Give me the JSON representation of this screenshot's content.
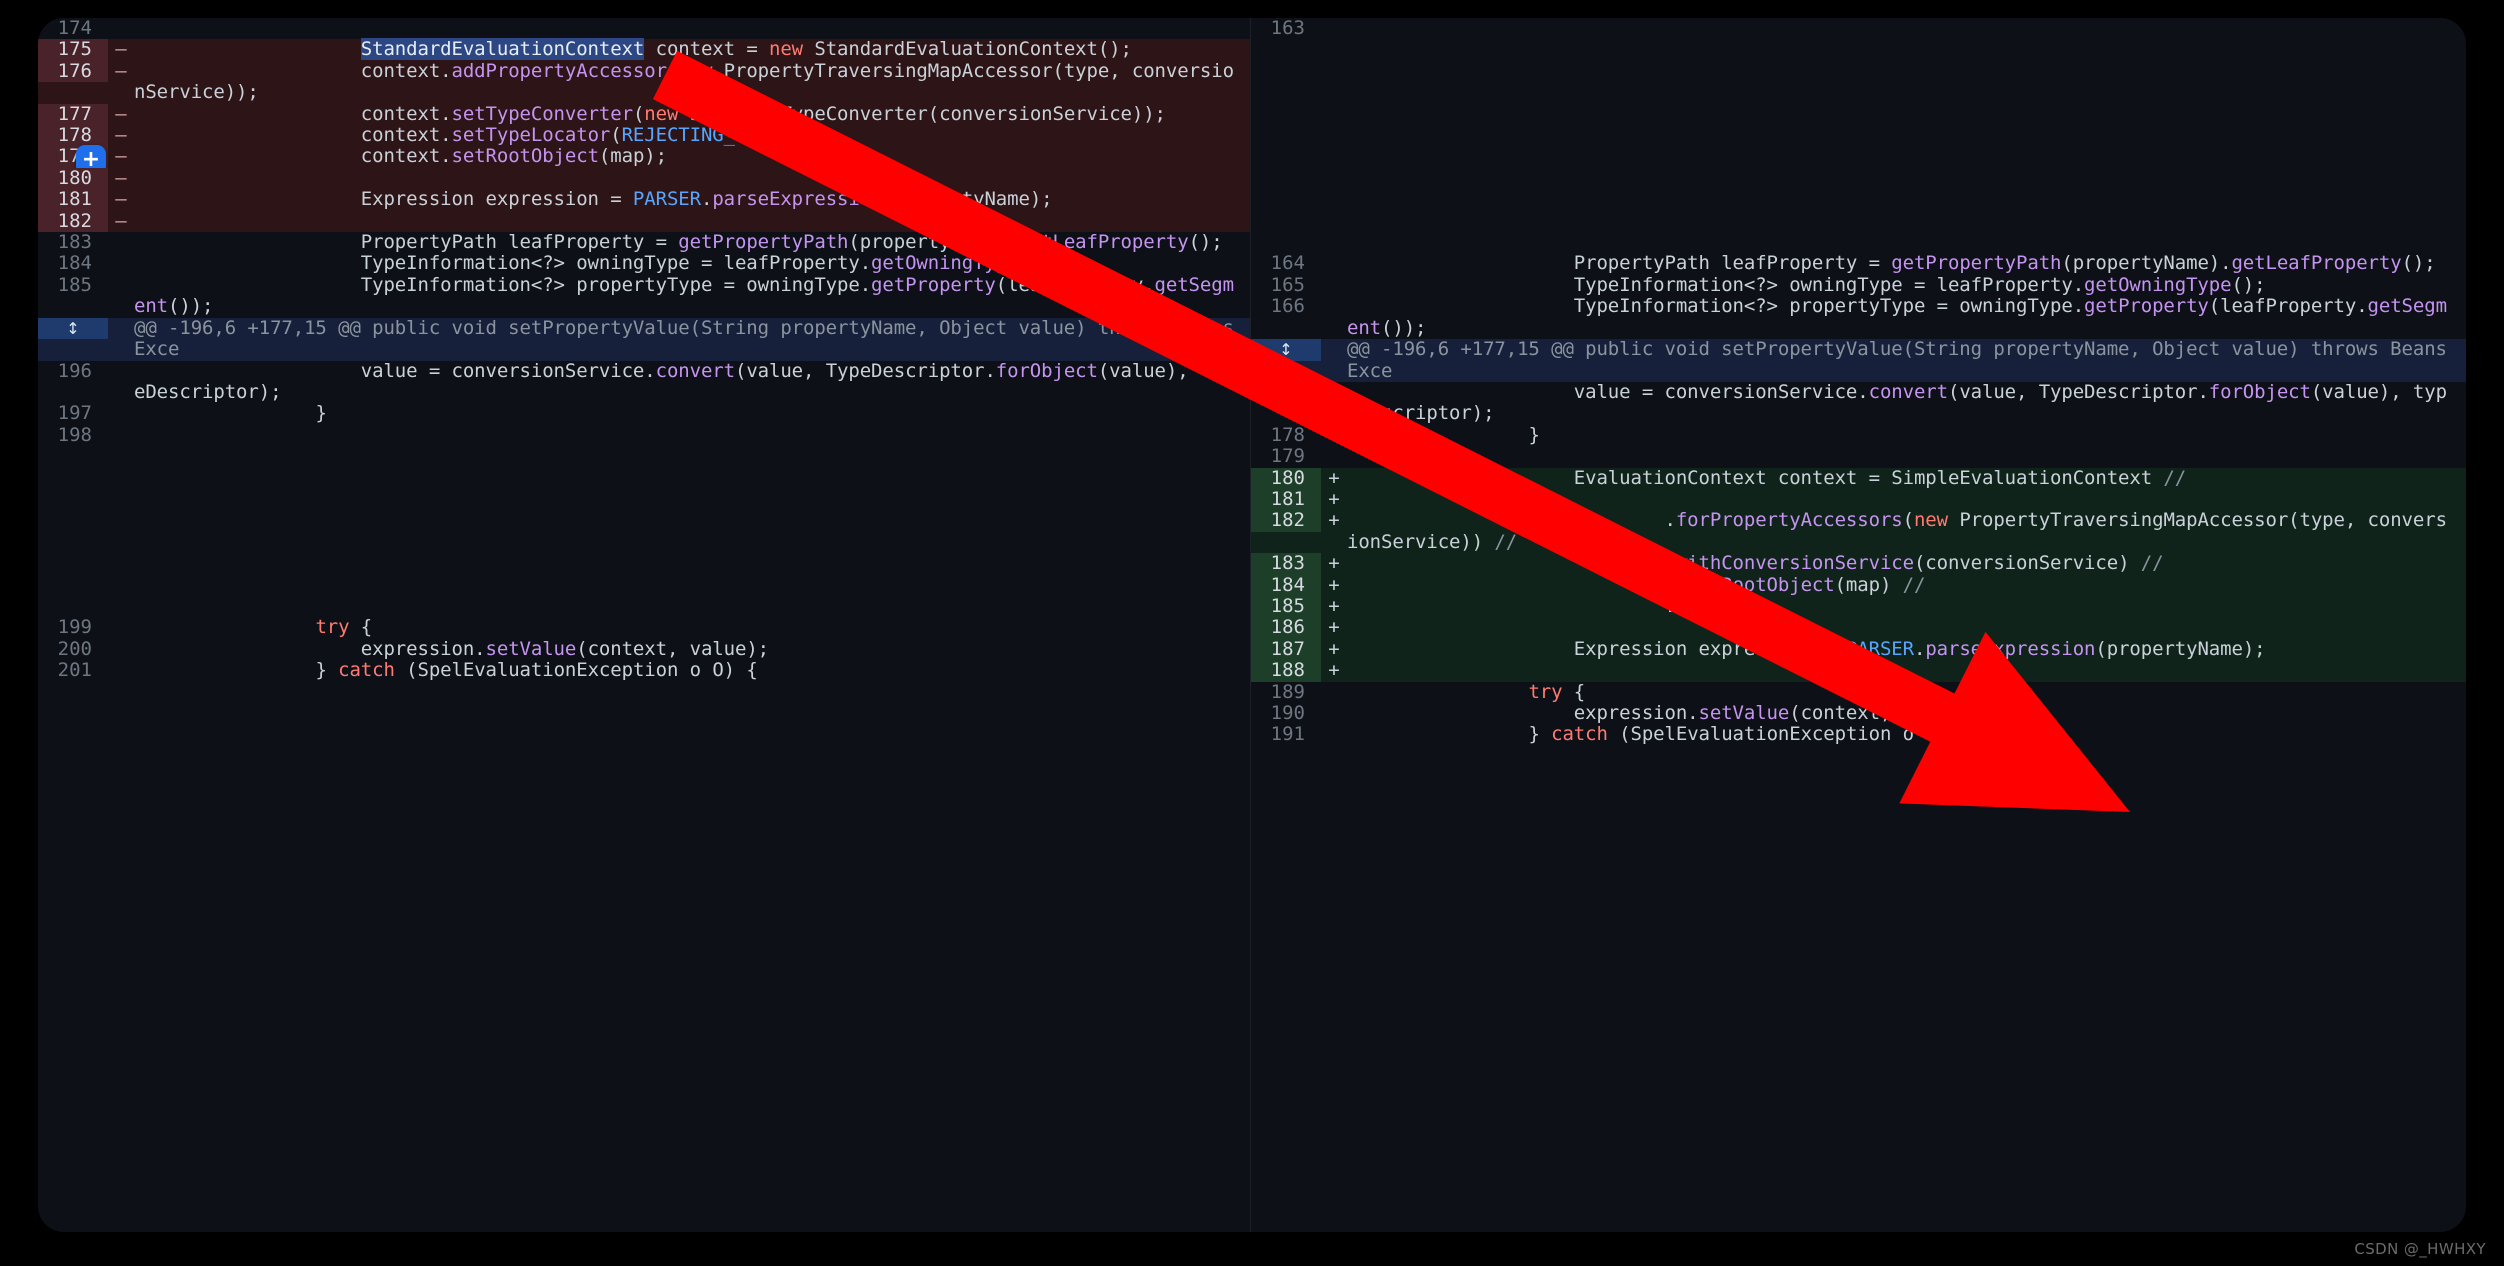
{
  "watermark": "CSDN @_HWHXY",
  "hunk": {
    "header": "@@ -196,6 +177,15 @@ public void setPropertyValue(String propertyName, Object value) throws BeansExce",
    "expand_icon": "↕"
  },
  "gutter_button": {
    "label": "+",
    "on_line": "179"
  },
  "left": {
    "rows": [
      {
        "num": "174",
        "sign": "",
        "type": "ctx",
        "code": ""
      },
      {
        "num": "175",
        "sign": "–",
        "type": "del",
        "code": "                    StandardEvaluationContext context = new StandardEvaluationContext();"
      },
      {
        "num": "176",
        "sign": "–",
        "type": "del",
        "code": "                    context.addPropertyAccessor(new PropertyTraversingMapAccessor(type, conversionService));"
      },
      {
        "num": "177",
        "sign": "–",
        "type": "del",
        "code": "                    context.setTypeConverter(new StandardTypeConverter(conversionService));"
      },
      {
        "num": "178",
        "sign": "–",
        "type": "del",
        "code": "                    context.setTypeLocator(REJECTING_LOCATOR);"
      },
      {
        "num": "179",
        "sign": "–",
        "type": "del",
        "code": "                    context.setRootObject(map);"
      },
      {
        "num": "180",
        "sign": "–",
        "type": "del",
        "code": ""
      },
      {
        "num": "181",
        "sign": "–",
        "type": "del",
        "code": "                    Expression expression = PARSER.parseExpression(propertyName);"
      },
      {
        "num": "182",
        "sign": "–",
        "type": "del",
        "code": ""
      },
      {
        "num": "183",
        "sign": "",
        "type": "ctx",
        "code": "                    PropertyPath leafProperty = getPropertyPath(propertyName).getLeafProperty();"
      },
      {
        "num": "184",
        "sign": "",
        "type": "ctx",
        "code": "                    TypeInformation<?> owningType = leafProperty.getOwningType();"
      },
      {
        "num": "185",
        "sign": "",
        "type": "ctx",
        "code": "                    TypeInformation<?> propertyType = owningType.getProperty(leafProperty.getSegment());"
      },
      {
        "num": "196",
        "sign": "",
        "type": "ctx",
        "code": "                    value = conversionService.convert(value, TypeDescriptor.forObject(value), typeDescriptor);"
      },
      {
        "num": "197",
        "sign": "",
        "type": "ctx",
        "code": "                }"
      },
      {
        "num": "198",
        "sign": "",
        "type": "ctx",
        "code": ""
      },
      {
        "num": "",
        "sign": "",
        "type": "blank",
        "code": ""
      },
      {
        "num": "",
        "sign": "",
        "type": "blank",
        "code": ""
      },
      {
        "num": "",
        "sign": "",
        "type": "blank",
        "code": ""
      },
      {
        "num": "",
        "sign": "",
        "type": "blank",
        "code": ""
      },
      {
        "num": "",
        "sign": "",
        "type": "blank",
        "code": ""
      },
      {
        "num": "",
        "sign": "",
        "type": "blank",
        "code": ""
      },
      {
        "num": "",
        "sign": "",
        "type": "blank",
        "code": ""
      },
      {
        "num": "",
        "sign": "",
        "type": "blank",
        "code": ""
      },
      {
        "num": "199",
        "sign": "",
        "type": "ctx",
        "code": "                try {"
      },
      {
        "num": "200",
        "sign": "",
        "type": "ctx",
        "code": "                    expression.setValue(context, value);"
      },
      {
        "num": "201",
        "sign": "",
        "type": "ctx",
        "code": "                } catch (SpelEvaluationException o O) {"
      }
    ]
  },
  "right": {
    "rows": [
      {
        "num": "163",
        "sign": "",
        "type": "ctx",
        "code": ""
      },
      {
        "num": "",
        "sign": "",
        "type": "blank",
        "code": ""
      },
      {
        "num": "",
        "sign": "",
        "type": "blank",
        "code": ""
      },
      {
        "num": "",
        "sign": "",
        "type": "blank",
        "code": ""
      },
      {
        "num": "",
        "sign": "",
        "type": "blank",
        "code": ""
      },
      {
        "num": "",
        "sign": "",
        "type": "blank",
        "code": ""
      },
      {
        "num": "",
        "sign": "",
        "type": "blank",
        "code": ""
      },
      {
        "num": "",
        "sign": "",
        "type": "blank",
        "code": ""
      },
      {
        "num": "",
        "sign": "",
        "type": "blank",
        "code": ""
      },
      {
        "num": "",
        "sign": "",
        "type": "blank",
        "code": ""
      },
      {
        "num": "",
        "sign": "",
        "type": "blank",
        "code": ""
      },
      {
        "num": "164",
        "sign": "",
        "type": "ctx",
        "code": "                    PropertyPath leafProperty = getPropertyPath(propertyName).getLeafProperty();"
      },
      {
        "num": "165",
        "sign": "",
        "type": "ctx",
        "code": "                    TypeInformation<?> owningType = leafProperty.getOwningType();"
      },
      {
        "num": "166",
        "sign": "",
        "type": "ctx",
        "code": "                    TypeInformation<?> propertyType = owningType.getProperty(leafProperty.getSegment());"
      },
      {
        "num": "177",
        "sign": "",
        "type": "ctx",
        "code": "                    value = conversionService.convert(value, TypeDescriptor.forObject(value), typeDescriptor);"
      },
      {
        "num": "178",
        "sign": "",
        "type": "ctx",
        "code": "                }"
      },
      {
        "num": "179",
        "sign": "",
        "type": "ctx",
        "code": ""
      },
      {
        "num": "180",
        "sign": "+",
        "type": "add",
        "code": "                    EvaluationContext context = SimpleEvaluationContext //"
      },
      {
        "num": "181",
        "sign": "+",
        "type": "add",
        "code": ""
      },
      {
        "num": "182",
        "sign": "+",
        "type": "add",
        "code": "                            .forPropertyAccessors(new PropertyTraversingMapAccessor(type, conversionService)) //"
      },
      {
        "num": "183",
        "sign": "+",
        "type": "add",
        "code": "                            .withConversionService(conversionService) //"
      },
      {
        "num": "184",
        "sign": "+",
        "type": "add",
        "code": "                            .withRootObject(map) //"
      },
      {
        "num": "185",
        "sign": "+",
        "type": "add",
        "code": "                            .build();"
      },
      {
        "num": "186",
        "sign": "+",
        "type": "add",
        "code": ""
      },
      {
        "num": "187",
        "sign": "+",
        "type": "add",
        "code": "                    Expression expression = PARSER.parseExpression(propertyName);"
      },
      {
        "num": "188",
        "sign": "+",
        "type": "add",
        "code": ""
      },
      {
        "num": "189",
        "sign": "",
        "type": "ctx",
        "code": "                try {"
      },
      {
        "num": "190",
        "sign": "",
        "type": "ctx",
        "code": "                    expression.setValue(context, value);"
      },
      {
        "num": "191",
        "sign": "",
        "type": "ctx",
        "code": "                } catch (SpelEvaluationException o O) {"
      }
    ]
  },
  "colors": {
    "bg": "#0d1117",
    "deleted_bg": "#2d1416",
    "deleted_gutter": "#4a2229",
    "added_bg": "#10231a",
    "added_gutter": "#1d3e28",
    "hunk_bg": "#16203a",
    "hunk_gutter": "#1f3b6e",
    "accent_blue": "#1f6feb",
    "annotation_arrow": "#ff0000",
    "selection": "#2d4785",
    "keyword": "#ff7b72",
    "function": "#c594f0",
    "constant": "#58a6ff",
    "comment": "#8b949e"
  }
}
